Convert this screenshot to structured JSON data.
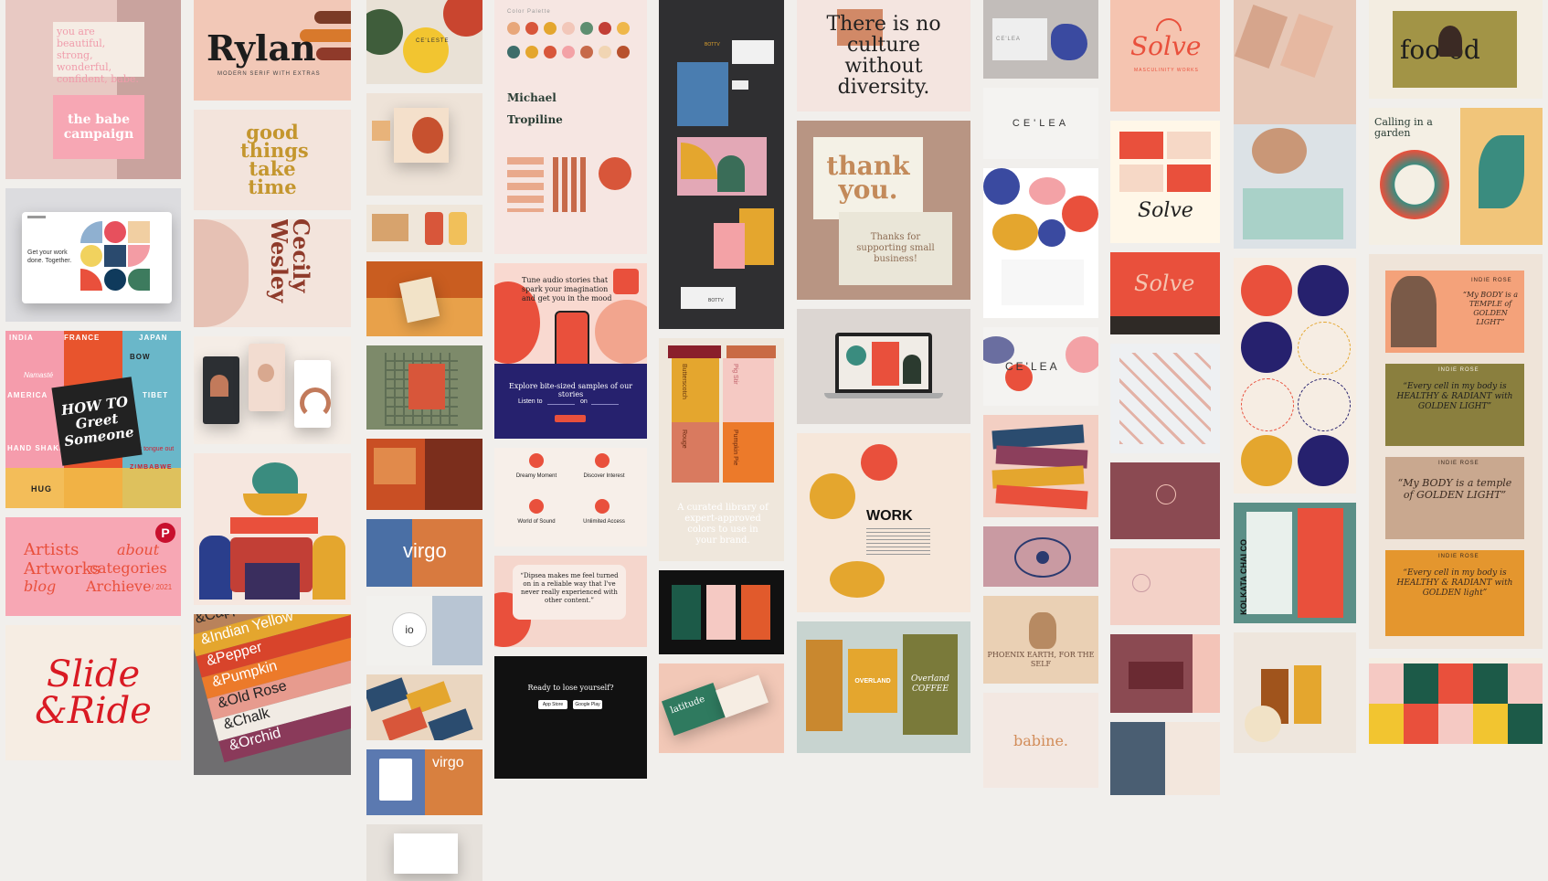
{
  "c1": {
    "babe_line": "you are beautiful, strong, wonderful, confident, babe.",
    "babe_campaign": "the babe campaign",
    "slide_title": "Slide &Ride",
    "get_card": "Get your work done. Together.",
    "travel_words": [
      "INDIA",
      "FRANCE",
      "JAPAN",
      "AMERICA",
      "TIBET",
      "BOW",
      "HAND SHAKE",
      "HUG",
      "Stick tongue out",
      "ZIMBABWE",
      "Namasté"
    ],
    "howto": "HOW TO Greet Someone",
    "pink_links": [
      "Artists",
      "about",
      "Artworks",
      "categories",
      "blog",
      "Archieve"
    ],
    "pink_year": "/ 2021"
  },
  "c2": {
    "rylan": "Rylan",
    "rylan_sub": "MODERN SERIF WITH EXTRAS",
    "good": "good things take time",
    "cecily": "Cecily Wesley",
    "stack": [
      "&Cappuccino",
      "&Indian Yellow",
      "&Pepper",
      "&Pumpkin",
      "&Old Rose",
      "&Chalk",
      "&Orchid"
    ]
  },
  "c3": {
    "celeste": "CE'LESTE",
    "virgo": "virgo",
    "virgo_logo": "io"
  },
  "c4": {
    "palette_label": "Color Palette",
    "font_names": [
      "Michael",
      "Tropiline"
    ],
    "hero": "Tune audio stories that spark your imagination and get you in the mood",
    "explore": "Explore bite-sized samples of our stories",
    "listen_to": "Listen to",
    "listen_on": "on",
    "features": [
      "Dreamy Moment",
      "Discover Interest",
      "World of Sound",
      "Unlimited Access"
    ],
    "quote": "“Dipsea makes me feel turned on in a reliable way that I've never really experienced with other content.”",
    "cta": "Ready to lose yourself?",
    "store_buttons": [
      "App Store",
      "Google Play"
    ]
  },
  "c5": {
    "brand_mark": "BOTTV",
    "swatch_names": [
      "Butterscotch",
      "Pig Stir",
      "Rouge",
      "Pumpkin Pie"
    ],
    "curated": "A curated library of expert-approved colors to use in your brand.",
    "latitude": "latitude"
  },
  "c6": {
    "culture": "There is no culture without diversity.",
    "thankyou": "thank you.",
    "thanks_support": "Thanks for supporting small business!",
    "work": "WORK",
    "overland": "OVERLAND",
    "coffee": "Overland COFFEE"
  },
  "c7": {
    "celea": "CE'LEA",
    "celea2": "CE'LEA",
    "phoenix": "PHOENIX EARTH, FOR THE SELF",
    "babine": "babine."
  },
  "c8": {
    "solve": "Solve",
    "solve_sub": "MASCULINITY WORKS"
  },
  "c9": {
    "chai": "KOLKATA CHAI CO"
  },
  "c10": {
    "food": "foo od",
    "calling": "Calling in a garden",
    "indie": "INDIE ROSE",
    "indie_quote1": "“My BODY is a TEMPLE of GOLDEN LIGHT”",
    "indie_quote2": "“Every cell in my body is HEALTHY & RADIANT with GOLDEN LIGHT”",
    "indie_quote3": "“My BODY is a temple of GOLDEN LIGHT”",
    "indie_quote4": "“Every cell in my body is HEALTHY & RADIANT with GOLDEN light”"
  },
  "colors": {
    "page_bg": "#f1efec",
    "pink": "#f7a7b4",
    "coral": "#e9503c",
    "mustard": "#e4a62e",
    "navy": "#26216e",
    "olive": "#7f7a3b"
  }
}
